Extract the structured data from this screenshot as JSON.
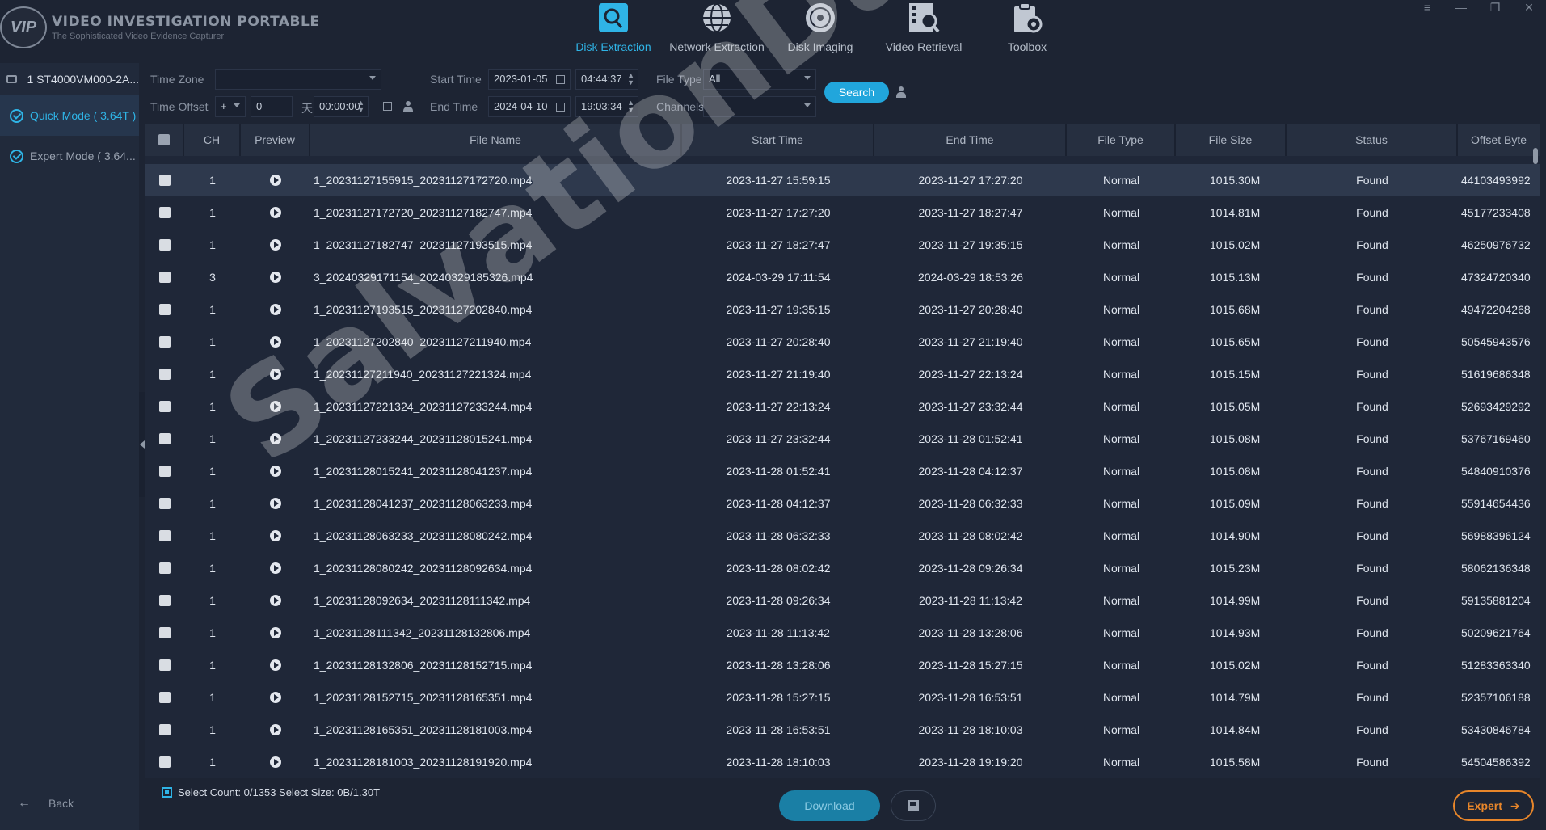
{
  "app": {
    "logo_badge": "VIP",
    "title": "VIDEO INVESTIGATION PORTABLE",
    "subtitle": "The Sophisticated Video Evidence Capturer"
  },
  "nav": [
    {
      "label": "Disk Extraction",
      "icon": "disk-extraction-icon",
      "active": true
    },
    {
      "label": "Network Extraction",
      "icon": "network-globe-icon",
      "active": false
    },
    {
      "label": "Disk Imaging",
      "icon": "disk-imaging-icon",
      "active": false
    },
    {
      "label": "Video Retrieval",
      "icon": "video-retrieval-icon",
      "active": false
    },
    {
      "label": "Toolbox",
      "icon": "toolbox-icon",
      "active": false
    }
  ],
  "window_controls": [
    "≡",
    "—",
    "❐",
    "✕"
  ],
  "sidebar": {
    "disk": "1 ST4000VM000-2A...",
    "modes": [
      {
        "label": "Quick Mode ( 3.64T )",
        "active": true
      },
      {
        "label": "Expert Mode ( 3.64...",
        "active": false
      }
    ],
    "back": "Back",
    "back_arrow": "←"
  },
  "filters": {
    "time_zone_label": "Time Zone",
    "time_zone_value": "",
    "time_offset_label": "Time Offset",
    "time_offset_sign": "+",
    "time_offset_days": "0",
    "time_offset_day_unit": "天",
    "time_offset_time": "00:00:00",
    "start_time_label": "Start Time",
    "start_date": "2023-01-05",
    "start_clock": "04:44:37",
    "end_time_label": "End Time",
    "end_date": "2024-04-10",
    "end_clock": "19:03:34",
    "file_type_label": "File Type",
    "file_type_value": "All",
    "channels_label": "Channels",
    "channels_value": "",
    "search_label": "Search"
  },
  "table": {
    "headers": [
      "",
      "CH",
      "Preview",
      "File Name",
      "Start Time",
      "End Time",
      "File Type",
      "File Size",
      "Status",
      "Offset Byte"
    ],
    "rows": [
      {
        "ch": "1",
        "file": "1_20231127155915_20231127172720.mp4",
        "start": "2023-11-27 15:59:15",
        "end": "2023-11-27 17:27:20",
        "type": "Normal",
        "size": "1015.30M",
        "status": "Found",
        "offset": "44103493992"
      },
      {
        "ch": "1",
        "file": "1_20231127172720_20231127182747.mp4",
        "start": "2023-11-27 17:27:20",
        "end": "2023-11-27 18:27:47",
        "type": "Normal",
        "size": "1014.81M",
        "status": "Found",
        "offset": "45177233408"
      },
      {
        "ch": "1",
        "file": "1_20231127182747_20231127193515.mp4",
        "start": "2023-11-27 18:27:47",
        "end": "2023-11-27 19:35:15",
        "type": "Normal",
        "size": "1015.02M",
        "status": "Found",
        "offset": "46250976732"
      },
      {
        "ch": "3",
        "file": "3_20240329171154_20240329185326.mp4",
        "start": "2024-03-29 17:11:54",
        "end": "2024-03-29 18:53:26",
        "type": "Normal",
        "size": "1015.13M",
        "status": "Found",
        "offset": "47324720340"
      },
      {
        "ch": "1",
        "file": "1_20231127193515_20231127202840.mp4",
        "start": "2023-11-27 19:35:15",
        "end": "2023-11-27 20:28:40",
        "type": "Normal",
        "size": "1015.68M",
        "status": "Found",
        "offset": "49472204268"
      },
      {
        "ch": "1",
        "file": "1_20231127202840_20231127211940.mp4",
        "start": "2023-11-27 20:28:40",
        "end": "2023-11-27 21:19:40",
        "type": "Normal",
        "size": "1015.65M",
        "status": "Found",
        "offset": "50545943576"
      },
      {
        "ch": "1",
        "file": "1_20231127211940_20231127221324.mp4",
        "start": "2023-11-27 21:19:40",
        "end": "2023-11-27 22:13:24",
        "type": "Normal",
        "size": "1015.15M",
        "status": "Found",
        "offset": "51619686348"
      },
      {
        "ch": "1",
        "file": "1_20231127221324_20231127233244.mp4",
        "start": "2023-11-27 22:13:24",
        "end": "2023-11-27 23:32:44",
        "type": "Normal",
        "size": "1015.05M",
        "status": "Found",
        "offset": "52693429292"
      },
      {
        "ch": "1",
        "file": "1_20231127233244_20231128015241.mp4",
        "start": "2023-11-27 23:32:44",
        "end": "2023-11-28 01:52:41",
        "type": "Normal",
        "size": "1015.08M",
        "status": "Found",
        "offset": "53767169460"
      },
      {
        "ch": "1",
        "file": "1_20231128015241_20231128041237.mp4",
        "start": "2023-11-28 01:52:41",
        "end": "2023-11-28 04:12:37",
        "type": "Normal",
        "size": "1015.08M",
        "status": "Found",
        "offset": "54840910376"
      },
      {
        "ch": "1",
        "file": "1_20231128041237_20231128063233.mp4",
        "start": "2023-11-28 04:12:37",
        "end": "2023-11-28 06:32:33",
        "type": "Normal",
        "size": "1015.09M",
        "status": "Found",
        "offset": "55914654436"
      },
      {
        "ch": "1",
        "file": "1_20231128063233_20231128080242.mp4",
        "start": "2023-11-28 06:32:33",
        "end": "2023-11-28 08:02:42",
        "type": "Normal",
        "size": "1014.90M",
        "status": "Found",
        "offset": "56988396124"
      },
      {
        "ch": "1",
        "file": "1_20231128080242_20231128092634.mp4",
        "start": "2023-11-28 08:02:42",
        "end": "2023-11-28 09:26:34",
        "type": "Normal",
        "size": "1015.23M",
        "status": "Found",
        "offset": "58062136348"
      },
      {
        "ch": "1",
        "file": "1_20231128092634_20231128111342.mp4",
        "start": "2023-11-28 09:26:34",
        "end": "2023-11-28 11:13:42",
        "type": "Normal",
        "size": "1014.99M",
        "status": "Found",
        "offset": "59135881204"
      },
      {
        "ch": "1",
        "file": "1_20231128111342_20231128132806.mp4",
        "start": "2023-11-28 11:13:42",
        "end": "2023-11-28 13:28:06",
        "type": "Normal",
        "size": "1014.93M",
        "status": "Found",
        "offset": "50209621764"
      },
      {
        "ch": "1",
        "file": "1_20231128132806_20231128152715.mp4",
        "start": "2023-11-28 13:28:06",
        "end": "2023-11-28 15:27:15",
        "type": "Normal",
        "size": "1015.02M",
        "status": "Found",
        "offset": "51283363340"
      },
      {
        "ch": "1",
        "file": "1_20231128152715_20231128165351.mp4",
        "start": "2023-11-28 15:27:15",
        "end": "2023-11-28 16:53:51",
        "type": "Normal",
        "size": "1014.79M",
        "status": "Found",
        "offset": "52357106188"
      },
      {
        "ch": "1",
        "file": "1_20231128165351_20231128181003.mp4",
        "start": "2023-11-28 16:53:51",
        "end": "2023-11-28 18:10:03",
        "type": "Normal",
        "size": "1014.84M",
        "status": "Found",
        "offset": "53430846784"
      },
      {
        "ch": "1",
        "file": "1_20231128181003_20231128191920.mp4",
        "start": "2023-11-28 18:10:03",
        "end": "2023-11-28 19:19:20",
        "type": "Normal",
        "size": "1015.58M",
        "status": "Found",
        "offset": "54504586392"
      }
    ]
  },
  "watermark": "SalvationData",
  "footer": {
    "select_info": "Select Count: 0/1353 Select Size: 0B/1.30T",
    "download": "Download",
    "expert": "Expert",
    "expert_arrow": "➔"
  },
  "colors": {
    "accent": "#2fb4e6",
    "expert": "#e8862a",
    "background": "#1d2433"
  }
}
